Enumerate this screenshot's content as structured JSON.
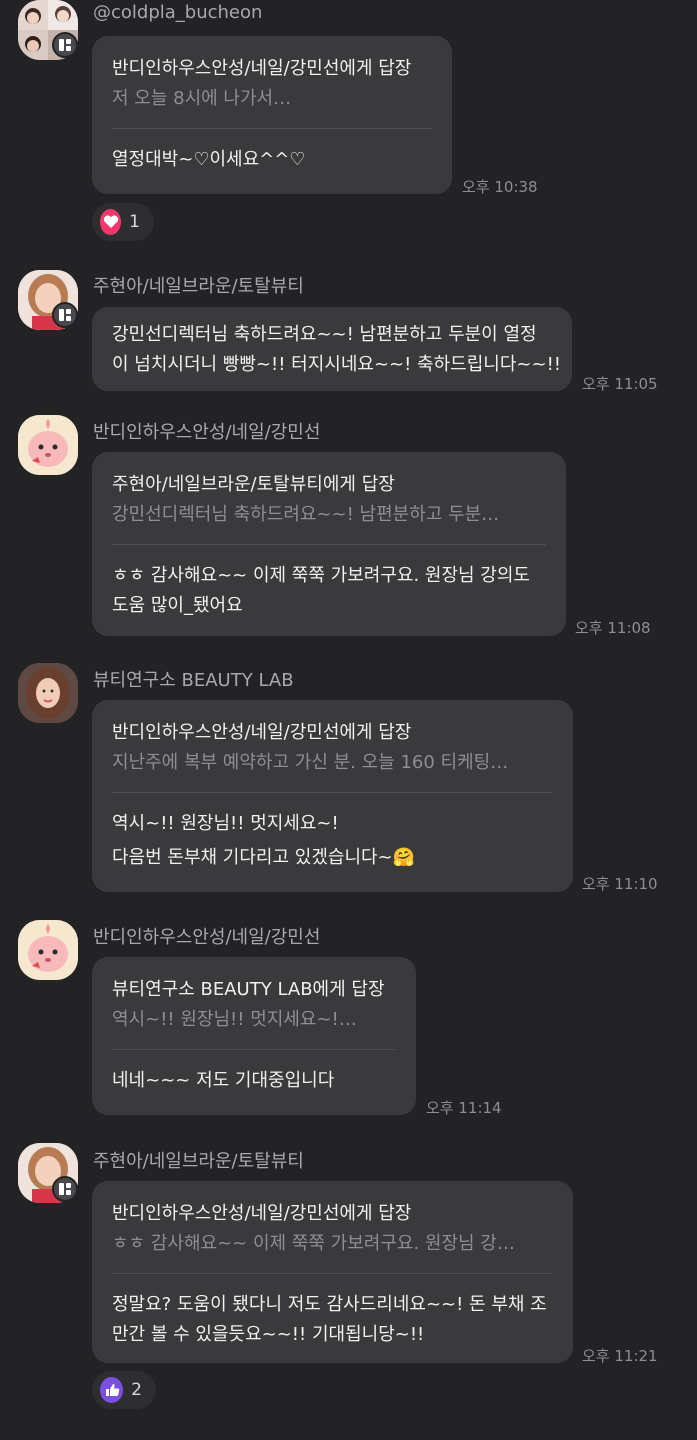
{
  "messages": [
    {
      "sender": "@coldpla_bucheon",
      "reply_to": "반디인하우스안성/네일/강민선에게 답장",
      "quote": "저 오늘 8시에 나가서…",
      "text": [
        "열정대박~♡이세요^^♡"
      ],
      "time": "오후 10:38",
      "reaction": {
        "icon": "heart-icon",
        "count": "1",
        "color": "#f2386b"
      }
    },
    {
      "sender": "주현아/네일브라운/토탈뷰티",
      "text": [
        "강민선디렉터님 축하드려요~~! 남편분하고 두분이 열정",
        "이 넘치시더니 빵빵~!! 터지시네요~~! 축하드립니다~~!!"
      ],
      "time": "오후 11:05"
    },
    {
      "sender": "반디인하우스안성/네일/강민선",
      "reply_to": "주현아/네일브라운/토탈뷰티에게 답장",
      "quote": "강민선디렉터님 축하드려요~~! 남편분하고 두분…",
      "text": [
        "ㅎㅎ 감사해요~~ 이제 쭉쭉 가보려구요. 원장님 강의도",
        "도움 많이_됐어요"
      ],
      "time": "오후 11:08"
    },
    {
      "sender": "뷰티연구소 BEAUTY LAB",
      "reply_to": "반디인하우스안성/네일/강민선에게 답장",
      "quote": "지난주에 복부 예약하고 가신 분. 오늘 160 티케팅…",
      "text": [
        "역시~!! 원장님!! 멋지세요~!",
        "다음번 돈부채 기다리고 있겠습니다~🤗"
      ],
      "time": "오후 11:10"
    },
    {
      "sender": "반디인하우스안성/네일/강민선",
      "reply_to": "뷰티연구소 BEAUTY LAB에게 답장",
      "quote": "역시~!! 원장님!! 멋지세요~!…",
      "text": [
        "네네~~~ 저도 기대중입니다"
      ],
      "time": "오후 11:14"
    },
    {
      "sender": "주현아/네일브라운/토탈뷰티",
      "reply_to": "반디인하우스안성/네일/강민선에게 답장",
      "quote": "ㅎㅎ 감사해요~~ 이제 쭉쭉 가보려구요. 원장님 강…",
      "text": [
        "정말요? 도움이 됐다니 저도 감사드리네요~~! 돈 부채 조",
        "만간 볼 수 있을듯요~~!! 기대됩니당~!!"
      ],
      "time": "오후 11:21",
      "reaction": {
        "icon": "thumbs-up-icon",
        "count": "2",
        "color": "#7b4fe0"
      }
    }
  ],
  "colors": {
    "background": "#232325",
    "bubble": "#3a3a3d",
    "muted_text": "#8e8e93"
  }
}
